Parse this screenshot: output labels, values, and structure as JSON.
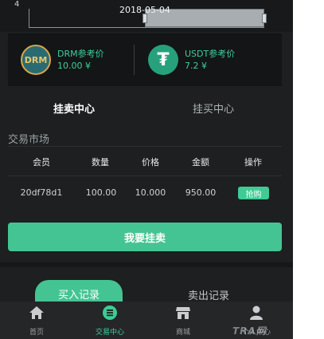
{
  "chart": {
    "axis_number": "4",
    "date_label": "2018-05-04"
  },
  "prices": [
    {
      "name": "DRM参考价",
      "value": "10.00 ¥",
      "logo_text": "DRM"
    },
    {
      "name": "USDT参考价",
      "value": "7.2 ¥",
      "logo_text": "₮"
    }
  ],
  "tabs": {
    "sell_center": "挂卖中心",
    "buy_center": "挂买中心"
  },
  "market": {
    "title": "交易市场",
    "columns": [
      "会员",
      "数量",
      "价格",
      "金额",
      "操作"
    ],
    "rows": [
      {
        "member": "20df78d1",
        "quantity": "100.00",
        "price": "10.000",
        "amount": "950.00",
        "action": "抢购"
      }
    ]
  },
  "actions": {
    "post_sell": "我要挂卖"
  },
  "records": {
    "buy": "买入记录",
    "sell": "卖出记录"
  },
  "nav": [
    {
      "label": "首页",
      "icon": "home-icon"
    },
    {
      "label": "交易中心",
      "icon": "trade-icon",
      "active": true
    },
    {
      "label": "商城",
      "icon": "store-icon"
    },
    {
      "label": "个人中心",
      "icon": "user-icon"
    }
  ],
  "watermark": "TRA网",
  "colors": {
    "accent": "#45c493",
    "background": "#1d1f20"
  }
}
